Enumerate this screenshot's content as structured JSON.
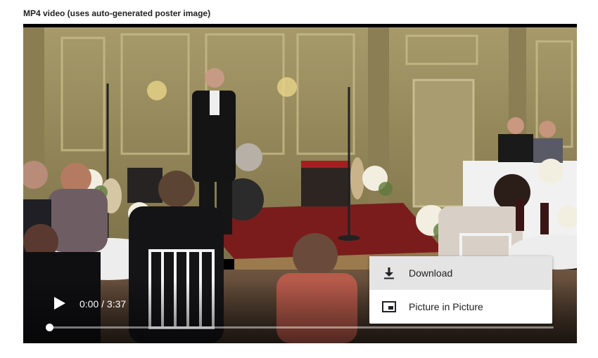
{
  "caption": "MP4 video (uses auto-generated poster image)",
  "player": {
    "time_display": "0:00 / 3:37",
    "progress": 0.0,
    "play_icon": "play-icon"
  },
  "context_menu": {
    "items": [
      {
        "label": "Download",
        "icon": "download-icon",
        "highlighted": true
      },
      {
        "label": "Picture in Picture",
        "icon": "picture-in-picture-icon",
        "highlighted": false
      }
    ]
  },
  "colors": {
    "menu_highlight": "#e4e4e4",
    "player_bg": "#000000"
  }
}
